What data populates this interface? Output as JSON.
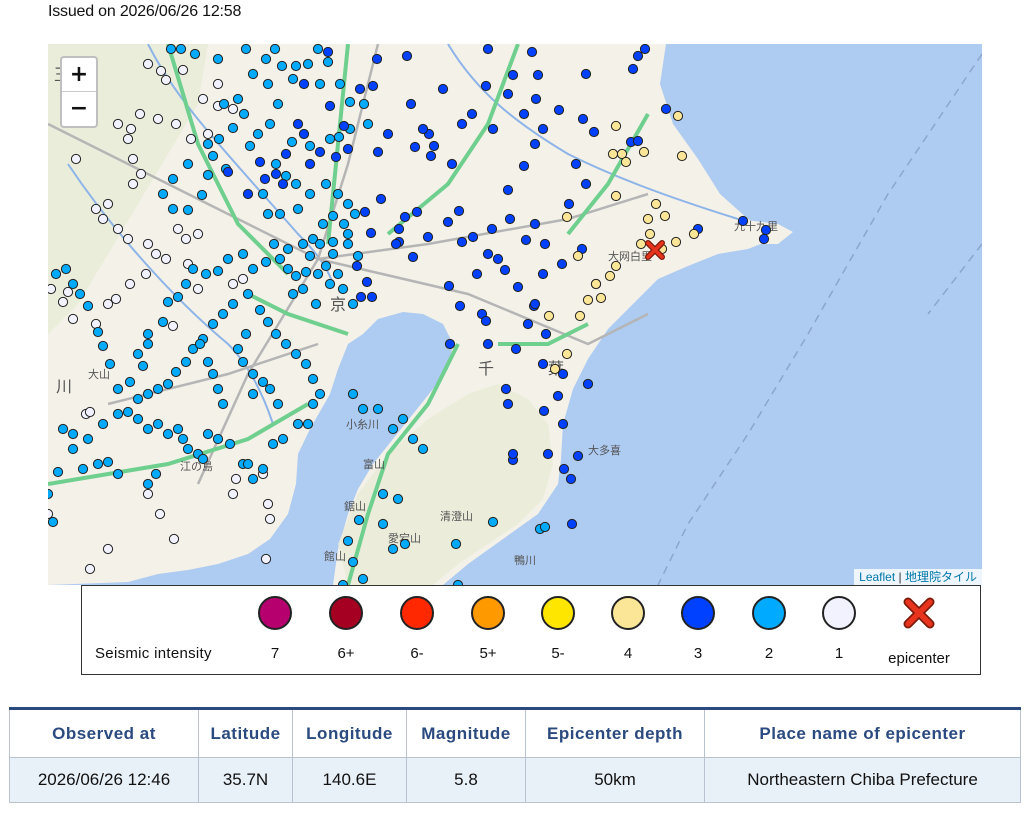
{
  "header": {
    "issued": "Issued on 2026/06/26 12:58"
  },
  "map": {
    "zoom_in": "+",
    "zoom_out": "−",
    "attribution_leaflet": "Leaflet",
    "attribution_sep": " | ",
    "attribution_tiles": "地理院タイル",
    "place_labels": [
      "玉",
      "千",
      "葉",
      "京",
      "川",
      "大山",
      "江の島",
      "小糸川",
      "清澄山",
      "大多喜",
      "愛宕山",
      "富山",
      "鋸山",
      "館山",
      "鴨川",
      "九十九里",
      "大网白里"
    ],
    "colors": {
      "sea": "#aecbf2",
      "land": "#f4f1e8",
      "highway": "#6fcf8e",
      "road": "#b5b5b5"
    }
  },
  "legend": {
    "title": "Seismic intensity",
    "items": [
      {
        "label": "7",
        "color": "#b5006e"
      },
      {
        "label": "6+",
        "color": "#a50021"
      },
      {
        "label": "6-",
        "color": "#ff2800"
      },
      {
        "label": "5+",
        "color": "#ff9900"
      },
      {
        "label": "5-",
        "color": "#ffe600"
      },
      {
        "label": "4",
        "color": "#fae696"
      },
      {
        "label": "3",
        "color": "#0041ff"
      },
      {
        "label": "2",
        "color": "#00aaff"
      },
      {
        "label": "1",
        "color": "#f2f2ff"
      }
    ],
    "epicenter_label": "epicenter",
    "epicenter_color": "#e8341c"
  },
  "info_table": {
    "headers": [
      "Observed at",
      "Latitude",
      "Longitude",
      "Magnitude",
      "Epicenter depth",
      "Place name of epicenter"
    ],
    "row": [
      "2026/06/26 12:46",
      "35.7N",
      "140.6E",
      "5.8",
      "50km",
      "Northeastern Chiba Prefecture"
    ]
  }
}
